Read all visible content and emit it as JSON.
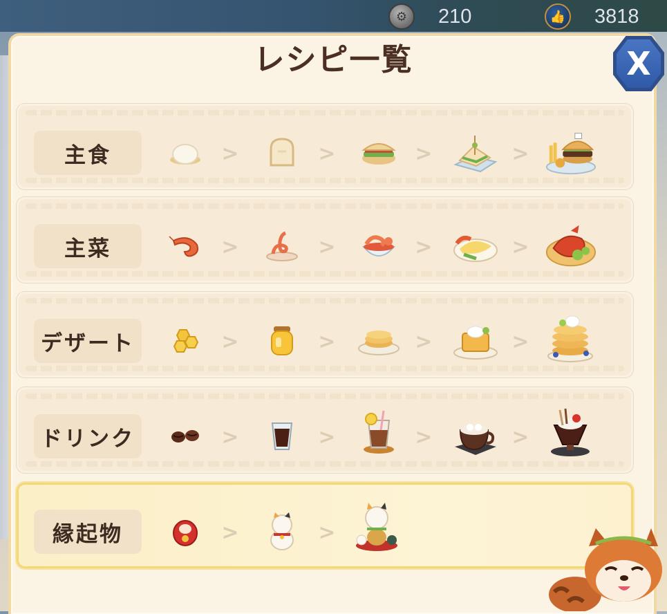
{
  "topbar": {
    "currencies": [
      {
        "icon": "coin-icon",
        "value": "210"
      },
      {
        "icon": "thumbs-up-icon",
        "value": "3818"
      }
    ]
  },
  "title": "レシピ一覧",
  "close_label": "X",
  "categories": [
    {
      "label": "主食",
      "items": [
        "rice-bun",
        "bread-slice",
        "sandwich-burger",
        "club-sandwich",
        "burger-platter"
      ]
    },
    {
      "label": "主菜",
      "items": [
        "shrimp",
        "shrimp-swirl",
        "shrimp-bowl",
        "omelette-plate",
        "lobster-platter"
      ]
    },
    {
      "label": "デザート",
      "items": [
        "honeycomb",
        "honey-jar",
        "pancake-plate",
        "honey-toast",
        "pancake-stack"
      ]
    },
    {
      "label": "ドリンク",
      "items": [
        "coffee-beans",
        "iced-coffee",
        "iced-coffee-lemon",
        "cat-latte",
        "chocolate-parfait"
      ]
    },
    {
      "label": "縁起物",
      "items": [
        "daruma",
        "maneki-neko",
        "maneki-neko-deluxe"
      ]
    }
  ],
  "colors": {
    "panel": "#fbf3e3",
    "row": "#f7ebd8",
    "highlight": "#fdf4d6",
    "title_text": "#4a2f22",
    "close_button": "#2f5aa8"
  }
}
